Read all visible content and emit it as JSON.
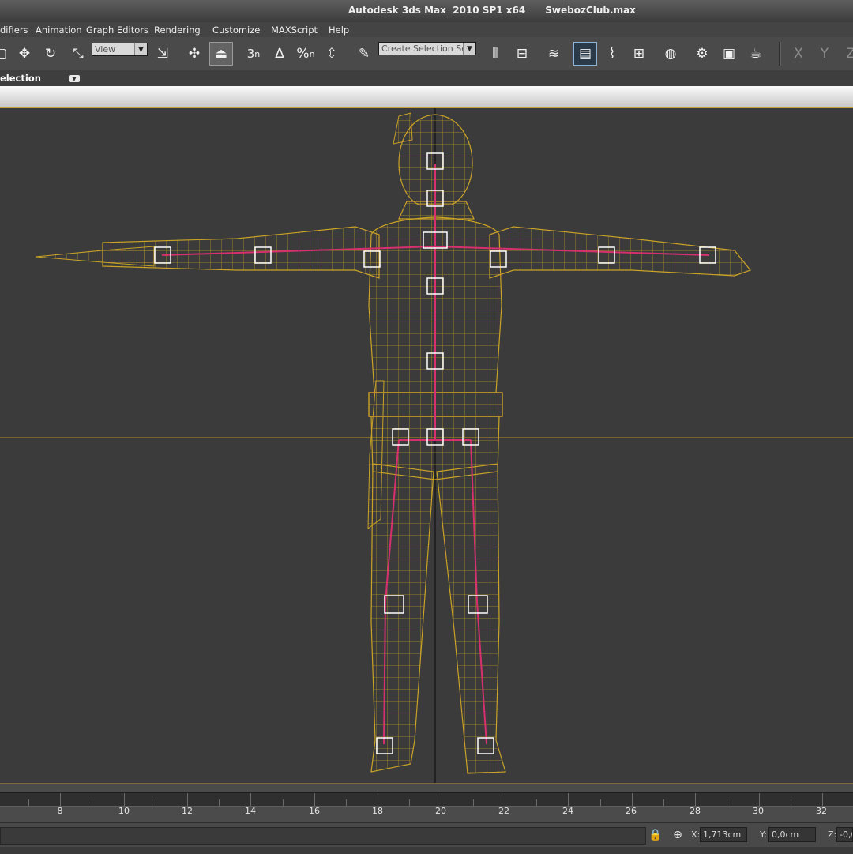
{
  "window": {
    "title": "Autodesk 3ds Max  2010 SP1 x64      SwebozClub.max"
  },
  "menu": [
    "difiers",
    "Animation",
    "Graph Editors",
    "Rendering",
    "Customize",
    "MAXScript",
    "Help"
  ],
  "toolbar": {
    "reference_coordinate": "View",
    "named_selection_placeholder": "Create Selection Se",
    "snap_3d": "3",
    "angle_snap": "∆",
    "percent_snap": "%",
    "axis_x": "X",
    "axis_y": "Y",
    "axis_z": "Z"
  },
  "ribbon": {
    "label": "election"
  },
  "timeline": {
    "labels": [
      "8",
      "10",
      "12",
      "14",
      "16",
      "18",
      "20",
      "22",
      "24",
      "26",
      "28",
      "30",
      "32"
    ]
  },
  "status": {
    "x_label": "X:",
    "x_value": "1,713cm",
    "y_label": "Y:",
    "y_value": "0,0cm",
    "z_label": "Z:",
    "z_value": "-0,0"
  },
  "colors": {
    "wireframe": "#c9a227",
    "bones": "#d6306e",
    "viewport_bg": "#3b3b3b",
    "accent_border": "#c7a23a"
  }
}
